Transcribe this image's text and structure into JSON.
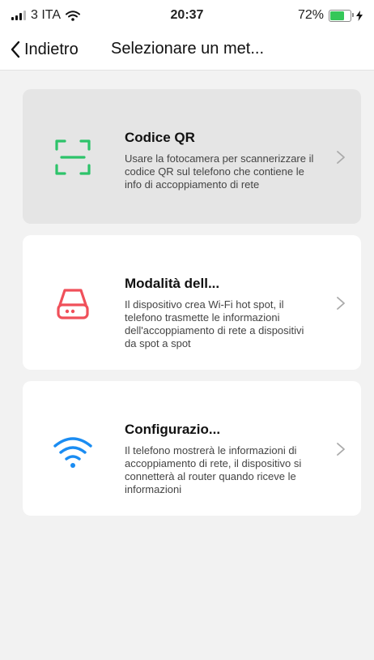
{
  "status_bar": {
    "carrier": "3 ITA",
    "time": "20:37",
    "battery_percent": "72%",
    "battery_level": 0.72,
    "colors": {
      "battery": "#35c759"
    },
    "icons": [
      "signal-icon",
      "wifi-icon",
      "battery-icon",
      "charging-bolt-icon"
    ]
  },
  "nav": {
    "back_label": "Indietro",
    "title": "Selezionare un met..."
  },
  "options": [
    {
      "title": "Codice QR",
      "description": "Usare la fotocamera per scannerizzare il codice QR sul telefono che contiene le info di accoppiamento di rete",
      "icon": "qr-scan-icon",
      "icon_color": "#2dc36a",
      "selected": true
    },
    {
      "title": "Modalità dell...",
      "description": "Il dispositivo crea Wi-Fi hot spot,  il telefono trasmette le informazioni dell'accoppiamento di rete a dispositivi da spot a spot",
      "icon": "router-icon",
      "icon_color": "#f0505a",
      "selected": false
    },
    {
      "title": "Configurazio...",
      "description": "Il telefono mostrerà le informazioni di accoppiamento di rete, il dispositivo si connetterà al router quando riceve le informazioni",
      "icon": "wifi-icon",
      "icon_color": "#1a8cf2",
      "selected": false
    }
  ]
}
